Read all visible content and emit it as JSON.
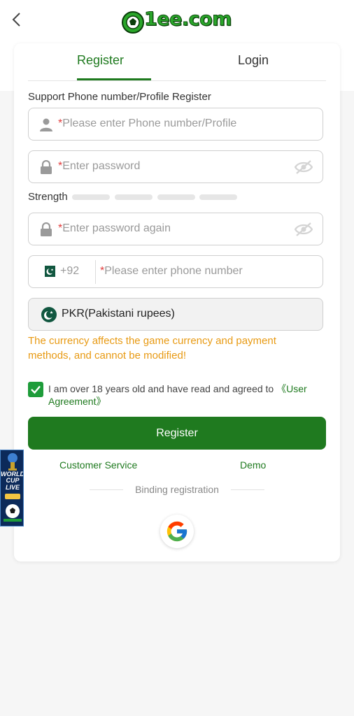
{
  "header": {
    "logo_text": "1ee.com"
  },
  "tabs": [
    {
      "label": "Register",
      "active": true
    },
    {
      "label": "Login",
      "active": false
    }
  ],
  "form": {
    "section_label": "Support Phone number/Profile Register",
    "required_mark": "*",
    "account_placeholder": "Please enter Phone number/Profile",
    "password_placeholder": "Enter password",
    "strength_label": "Strength",
    "strength_level": 0,
    "confirm_placeholder": "Enter password again",
    "country_code": "+92",
    "phone_placeholder": "Please enter phone number",
    "currency": "PKR(Pakistani rupees)",
    "currency_notice": "The currency affects the game currency and payment methods, and cannot be modified!",
    "agree_checked": true,
    "agree_text": "I am over 18 years old and have read and agreed to ",
    "agree_link": "《User Agreement》",
    "register_button": "Register"
  },
  "links": {
    "customer_service": "Customer Service",
    "demo": "Demo"
  },
  "binding_label": "Binding registration",
  "promo": {
    "line1": "WORLD CUP",
    "line2": "LIVE"
  },
  "colors": {
    "accent": "#1f7a1f",
    "notice": "#e89a13",
    "required": "#e23b3b",
    "checkbox": "#1e9c3a"
  }
}
